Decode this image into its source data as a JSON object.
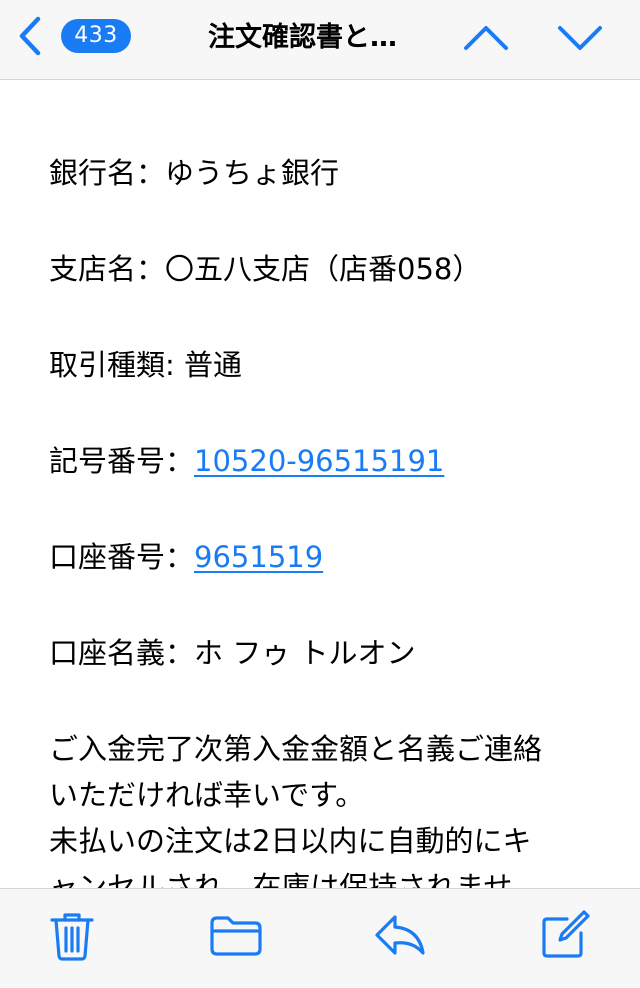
{
  "nav": {
    "back_count": "433",
    "title": "注文確認書と…"
  },
  "mail": {
    "bank": {
      "label": "銀行名：",
      "value": "ゆうちょ銀行"
    },
    "branch": {
      "label": "支店名：",
      "value": "〇五八支店（店番058）"
    },
    "type": {
      "label": "取引種類: ",
      "value": "普通"
    },
    "symbol": {
      "label": "記号番号：",
      "value": "10520-96515191"
    },
    "account": {
      "label": "口座番号：",
      "value": "9651519"
    },
    "holder": {
      "label": "口座名義：",
      "value": "ホ フゥ トルオン"
    },
    "message": {
      "line1": "ご入金完了次第入金金額と名義ご連絡",
      "line2": "いただければ幸いです。",
      "line3": "未払いの注文は2日以内に自動的にキ",
      "line4": "ャンセルされ、在庫は保持されませ"
    }
  },
  "toolbar": {
    "trash": "trash-icon",
    "folder": "folder-icon",
    "reply": "reply-icon",
    "compose": "compose-icon"
  },
  "colors": {
    "accent": "#1a7cf5",
    "bar_background": "#f7f7f7",
    "text": "#000000"
  }
}
